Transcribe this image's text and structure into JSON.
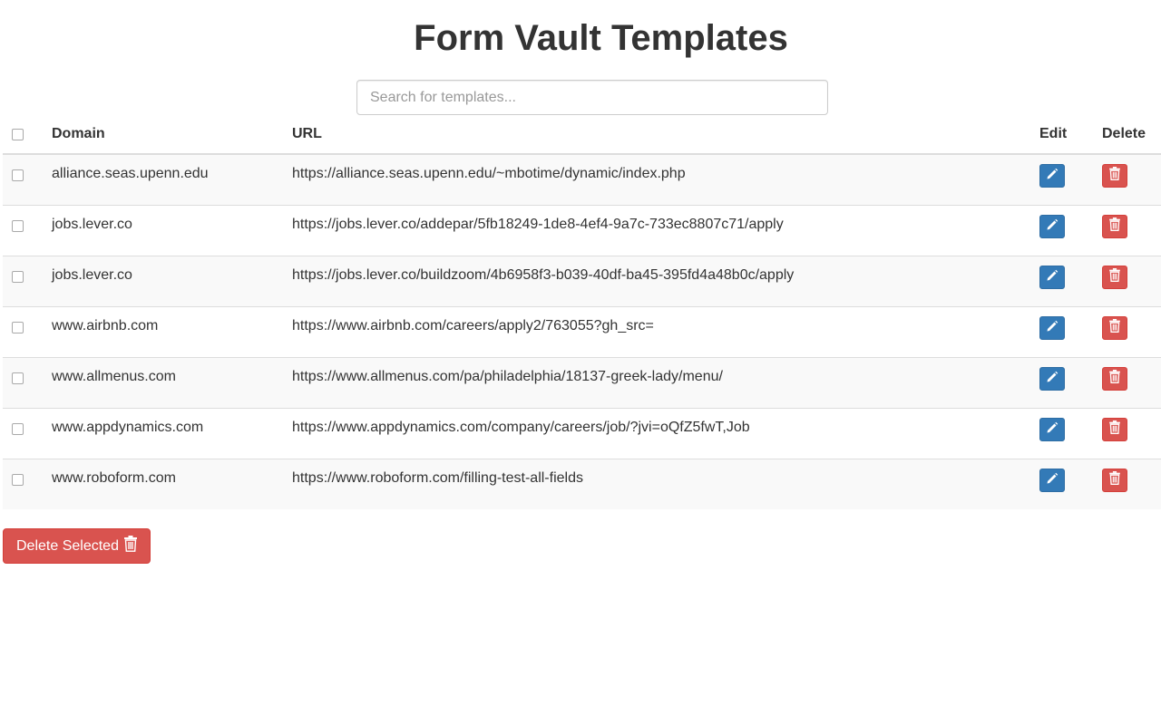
{
  "page": {
    "title": "Form Vault Templates"
  },
  "search": {
    "placeholder": "Search for templates...",
    "value": ""
  },
  "table": {
    "headers": {
      "domain": "Domain",
      "url": "URL",
      "edit": "Edit",
      "delete": "Delete"
    },
    "rows": [
      {
        "domain": "alliance.seas.upenn.edu",
        "url": "https://alliance.seas.upenn.edu/~mbotime/dynamic/index.php"
      },
      {
        "domain": "jobs.lever.co",
        "url": "https://jobs.lever.co/addepar/5fb18249-1de8-4ef4-9a7c-733ec8807c71/apply"
      },
      {
        "domain": "jobs.lever.co",
        "url": "https://jobs.lever.co/buildzoom/4b6958f3-b039-40df-ba45-395fd4a48b0c/apply"
      },
      {
        "domain": "www.airbnb.com",
        "url": "https://www.airbnb.com/careers/apply2/763055?gh_src="
      },
      {
        "domain": "www.allmenus.com",
        "url": "https://www.allmenus.com/pa/philadelphia/18137-greek-lady/menu/"
      },
      {
        "domain": "www.appdynamics.com",
        "url": "https://www.appdynamics.com/company/careers/job/?jvi=oQfZ5fwT,Job"
      },
      {
        "domain": "www.roboform.com",
        "url": "https://www.roboform.com/filling-test-all-fields"
      }
    ]
  },
  "actions": {
    "delete_selected_label": "Delete Selected"
  },
  "icons": {
    "edit": "pencil-icon",
    "delete": "trash-icon"
  },
  "colors": {
    "primary": "#337ab7",
    "danger": "#d9534f",
    "stripe": "#f9f9f9",
    "border": "#dddddd"
  }
}
